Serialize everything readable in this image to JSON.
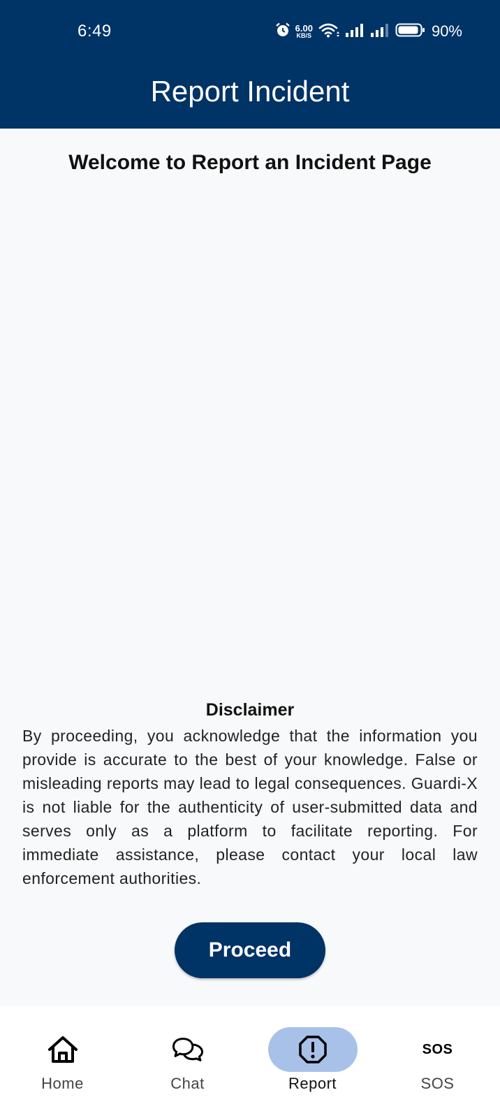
{
  "status_bar": {
    "time": "6:49",
    "net_speed_value": "6.00",
    "net_speed_unit": "KB/S",
    "battery_percent": "90%",
    "icons": [
      "alarm-icon",
      "wifi-icon",
      "signal-icon",
      "signal-icon",
      "battery-icon"
    ]
  },
  "app_bar": {
    "title": "Report Incident"
  },
  "content": {
    "welcome": "Welcome to Report an Incident Page",
    "disclaimer_title": "Disclaimer",
    "disclaimer_text": "By proceeding, you acknowledge that the information you provide is accurate to the best of your knowledge. False or misleading reports may lead to legal consequences. Guardi-X is not liable for the authenticity of user-submitted data and serves only as a platform to facilitate reporting. For immediate assistance, please contact your local law enforcement authorities.",
    "proceed_label": "Proceed"
  },
  "bottom_nav": {
    "items": [
      {
        "label": "Home",
        "icon": "home-icon"
      },
      {
        "label": "Chat",
        "icon": "chat-icon"
      },
      {
        "label": "Report",
        "icon": "report-icon",
        "active": true
      },
      {
        "label": "SOS",
        "icon": "sos-icon",
        "glyph": "SOS"
      }
    ]
  },
  "colors": {
    "primary": "#003366",
    "active_pill": "#a8c1e8",
    "background": "#f8f9fa"
  }
}
